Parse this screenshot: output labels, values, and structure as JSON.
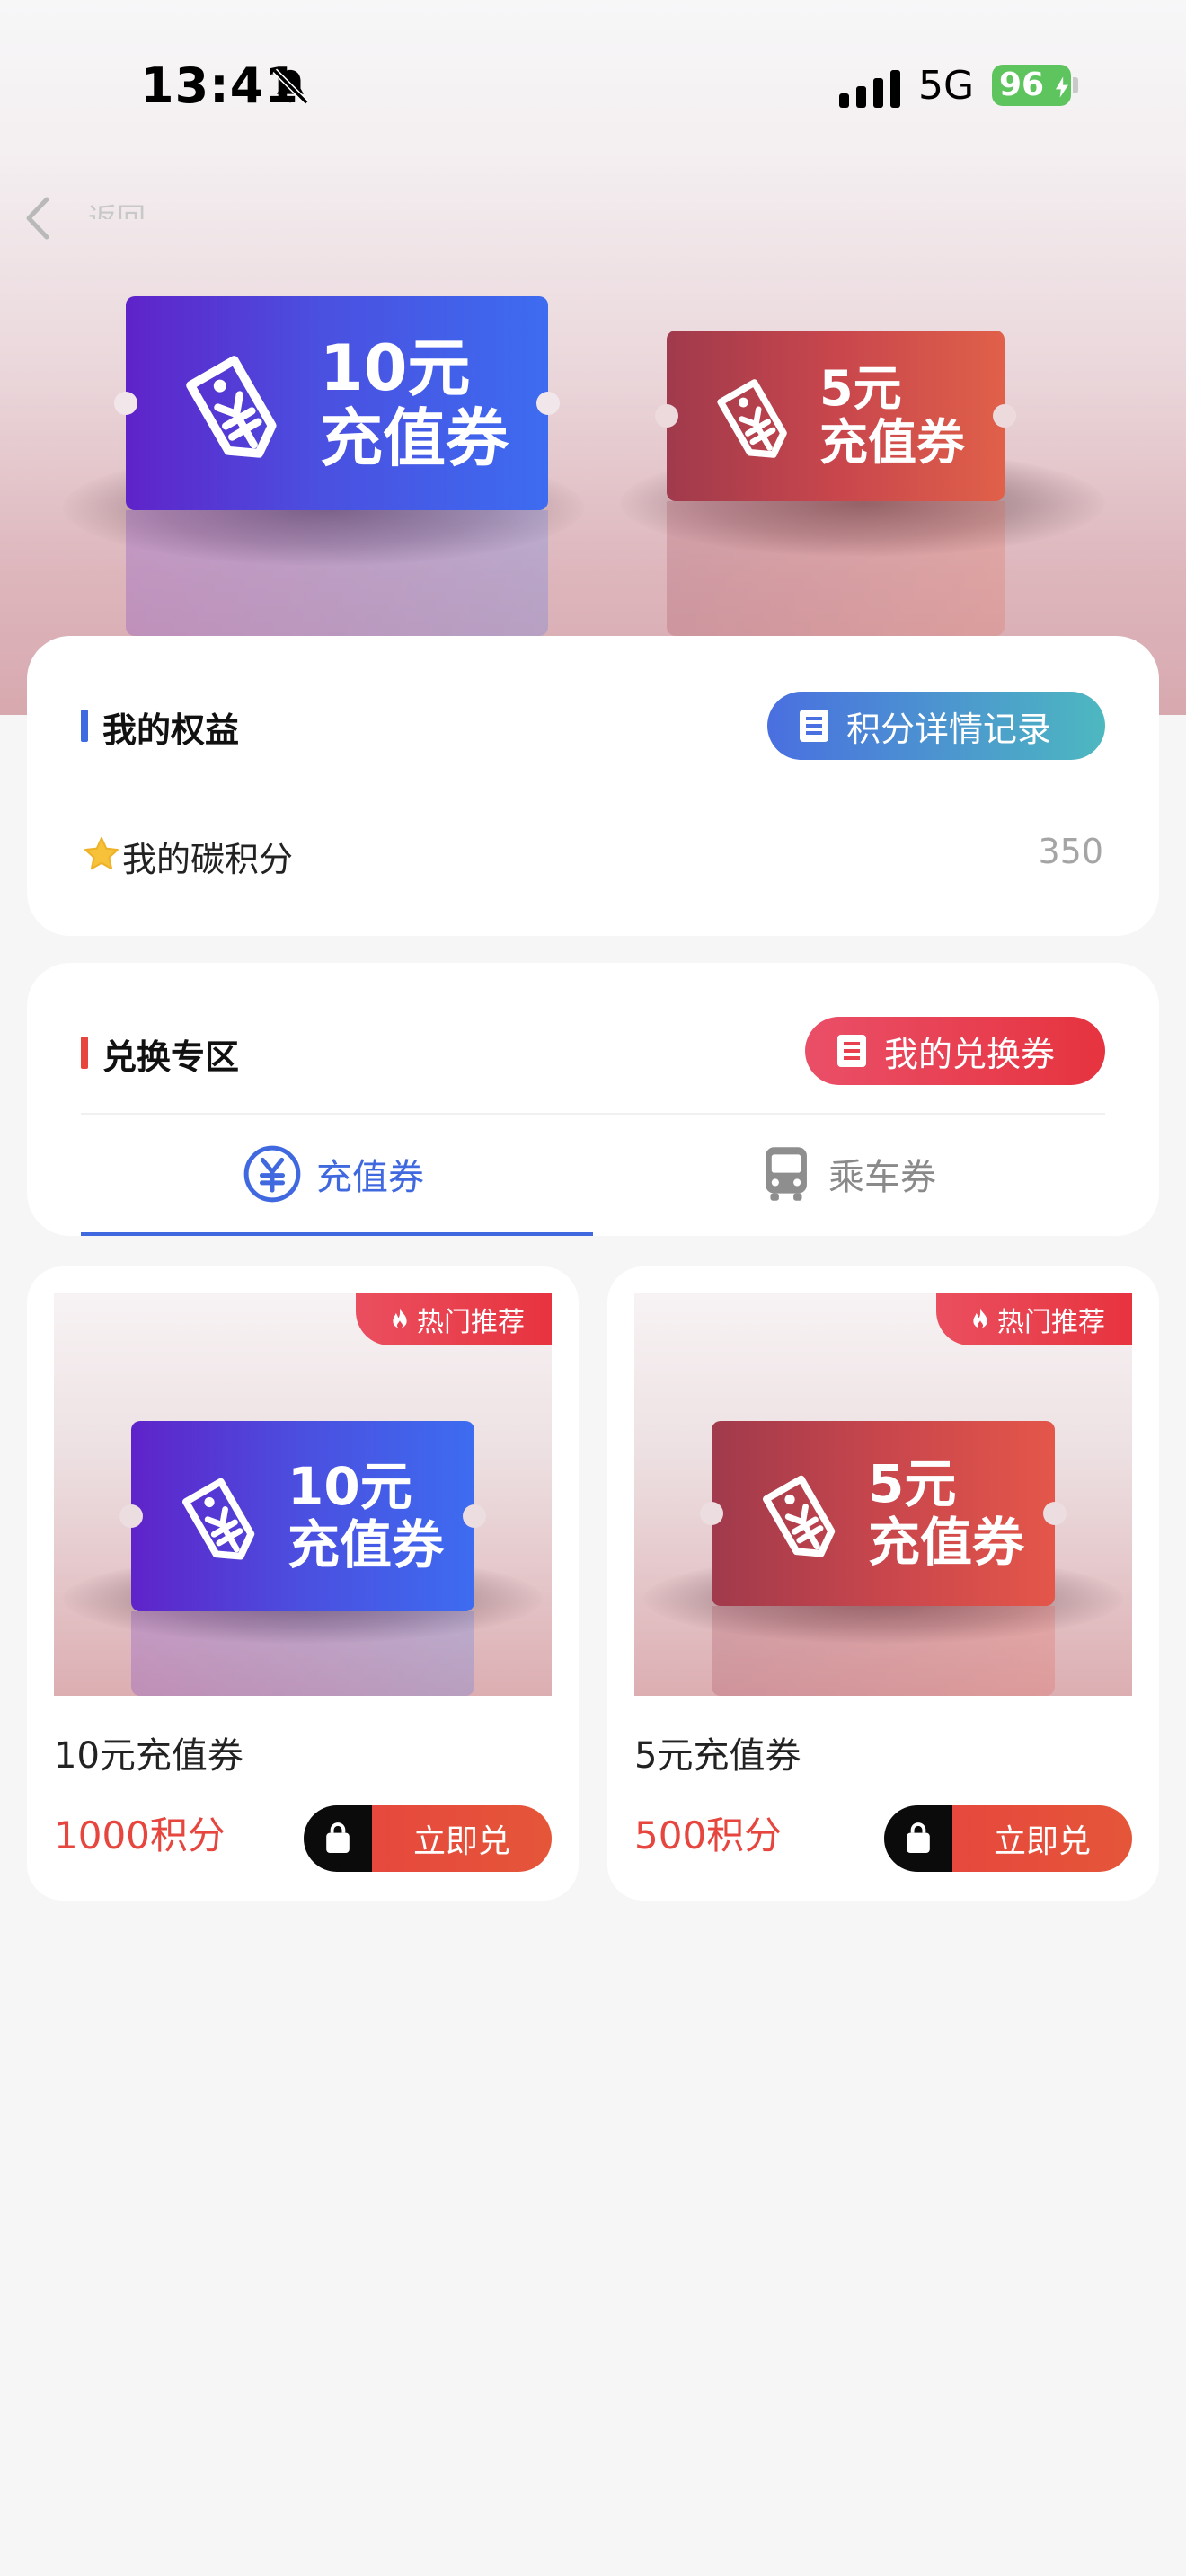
{
  "status_bar": {
    "time": "13:41",
    "network": "5G",
    "battery": "96"
  },
  "nav": {
    "back_label": "返回"
  },
  "banner": {
    "coupons": [
      {
        "amount": "10元",
        "name": "充值券"
      },
      {
        "amount": "5元",
        "name": "充值券"
      }
    ]
  },
  "rights": {
    "title": "我的权益",
    "detail_button": "积分详情记录",
    "carbon_label": "我的碳积分",
    "carbon_value": "350"
  },
  "exchange": {
    "title": "兑换专区",
    "my_coupons_button": "我的兑换券",
    "tabs": [
      {
        "label": "充值券",
        "active": true
      },
      {
        "label": "乘车券",
        "active": false
      }
    ]
  },
  "products": [
    {
      "badge": "热门推荐",
      "amount": "10元",
      "coupon": "充值券",
      "name": "10元充值券",
      "price": "1000积分",
      "action": "立即兑"
    },
    {
      "badge": "热门推荐",
      "amount": "5元",
      "coupon": "充值券",
      "name": "5元充值券",
      "price": "500积分",
      "action": "立即兑"
    }
  ],
  "colors": {
    "accent_blue": "#4069e0",
    "accent_red": "#e6463d",
    "battery_green": "#5ec45e"
  }
}
